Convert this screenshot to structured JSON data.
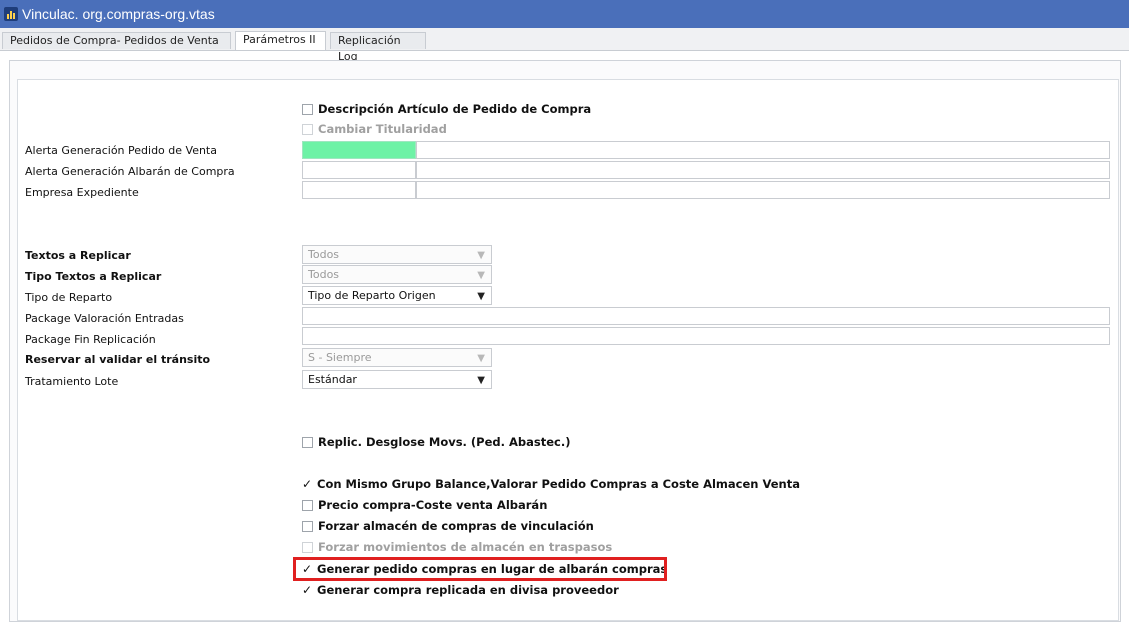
{
  "window": {
    "title": "Vinculac. org.compras-org.vtas"
  },
  "tabs": [
    {
      "label": "Pedidos de Compra- Pedidos de Venta"
    },
    {
      "label": "Parámetros II"
    },
    {
      "label": "Replicación Log"
    }
  ],
  "checkboxes_top": [
    {
      "label": "Descripción Artículo de Pedido de Compra",
      "checked": false,
      "disabled": false
    },
    {
      "label": "Cambiar Titularidad",
      "checked": false,
      "disabled": true
    }
  ],
  "fields": [
    {
      "label": "Alerta Generación Pedido de Venta"
    },
    {
      "label": "Alerta Generación Albarán de Compra"
    },
    {
      "label": "Empresa Expediente"
    }
  ],
  "selects": [
    {
      "label": "Textos a Replicar",
      "value": "Todos",
      "disabled": true
    },
    {
      "label": "Tipo Textos a Replicar",
      "value": "Todos",
      "disabled": true
    },
    {
      "label": "Tipo de Reparto",
      "value": "Tipo de Reparto Origen",
      "disabled": false
    },
    {
      "label": "Package Valoración Entradas",
      "value": ""
    },
    {
      "label": "Package Fin Replicación",
      "value": ""
    },
    {
      "label": "Reservar al validar el tránsito",
      "value": "S - Siempre",
      "disabled": true
    },
    {
      "label": "Tratamiento Lote",
      "value": "Estándar",
      "disabled": false
    }
  ],
  "checkboxes_bottom": [
    {
      "label": "Replic. Desglose Movs. (Ped. Abastec.)",
      "checked": false,
      "disabled": false
    },
    {
      "label": "Con Mismo Grupo Balance,Valorar Pedido Compras  a Coste Almacen Venta",
      "checked": true,
      "disabled": false
    },
    {
      "label": "Precio compra-Coste venta Albarán",
      "checked": false,
      "disabled": false
    },
    {
      "label": "Forzar almacén de compras de vinculación",
      "checked": false,
      "disabled": false
    },
    {
      "label": "Forzar movimientos de almacén en traspasos",
      "checked": false,
      "disabled": true
    },
    {
      "label": "Generar pedido compras en lugar de albarán compras",
      "checked": true,
      "disabled": false
    },
    {
      "label": "Generar compra replicada en divisa proveedor",
      "checked": true,
      "disabled": false
    }
  ],
  "symbols": {
    "check": "✓",
    "arrow": "▼"
  },
  "colors": {
    "titlebar": "#4a6fba",
    "green_field": "#6ef2a6",
    "highlight": "#e02020"
  }
}
